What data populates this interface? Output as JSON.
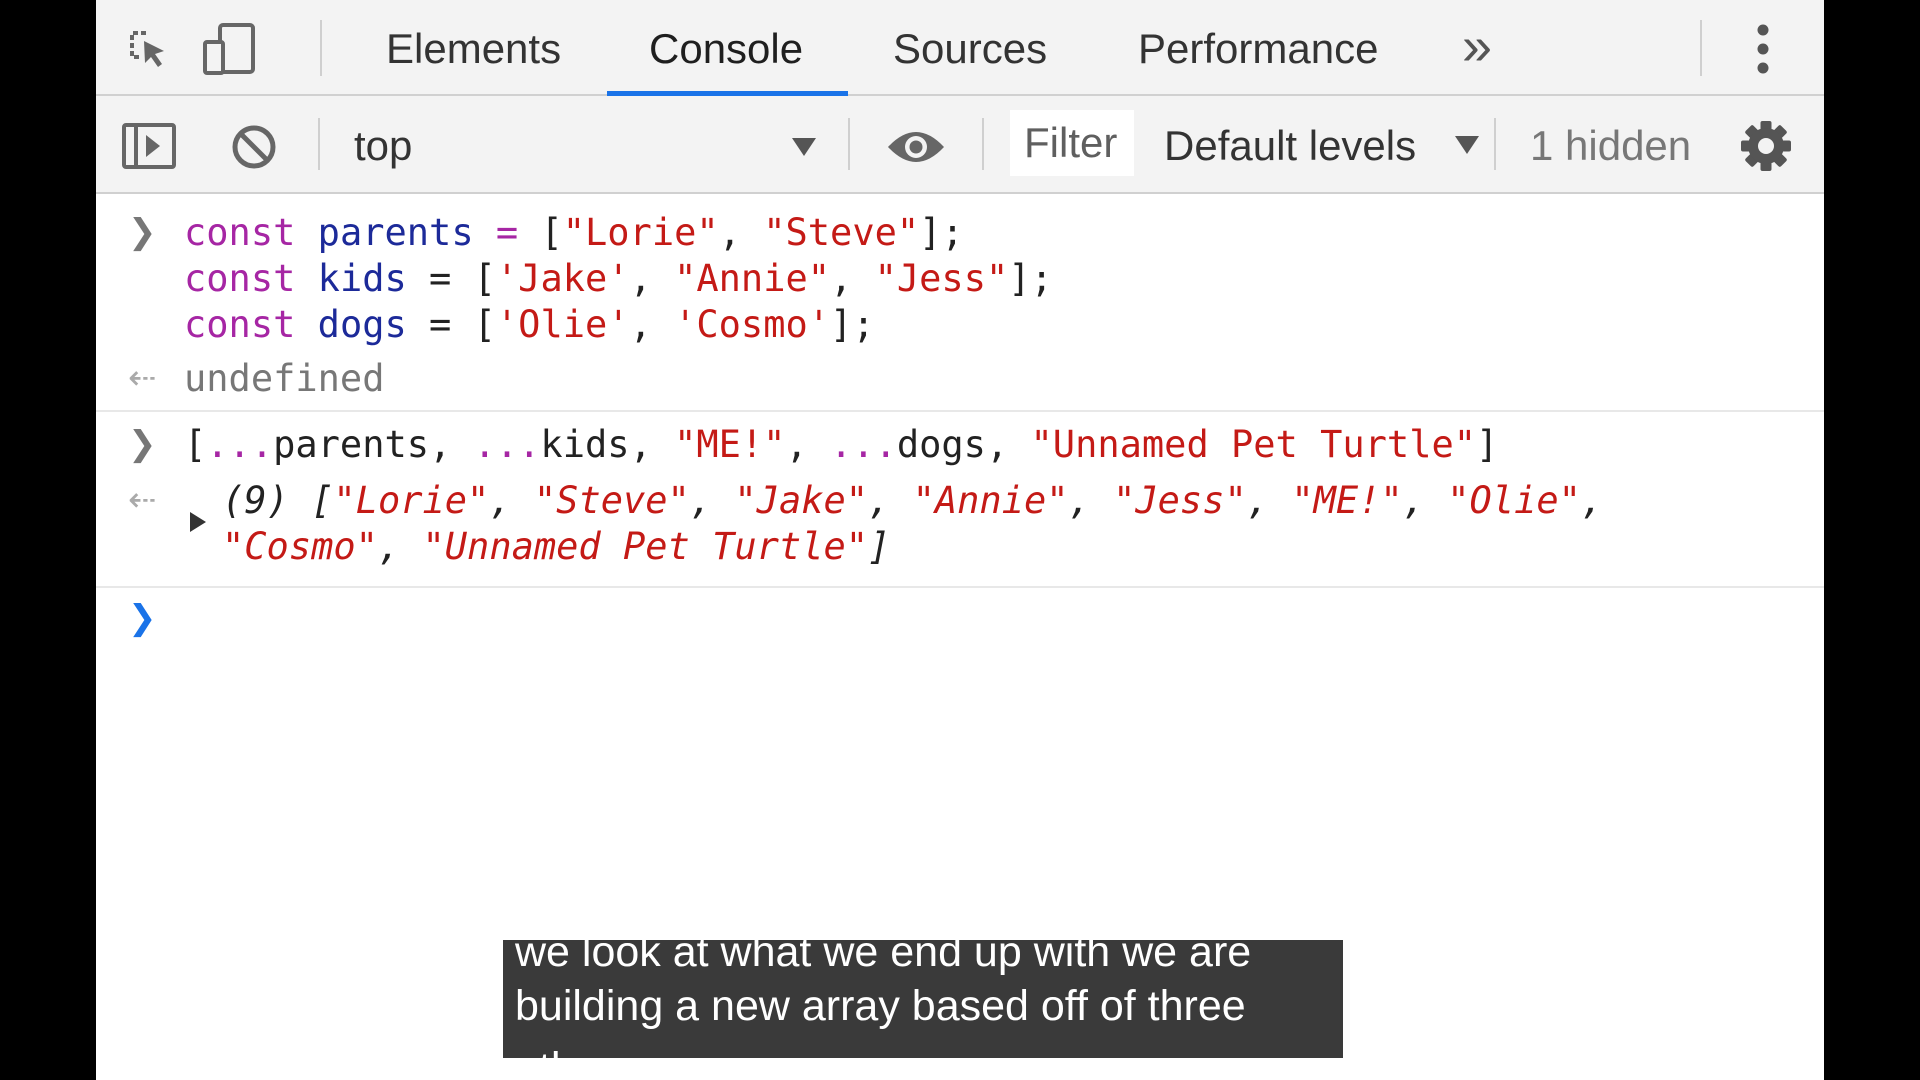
{
  "tabbar": {
    "tabs": [
      {
        "label": "Elements",
        "active": false
      },
      {
        "label": "Console",
        "active": true
      },
      {
        "label": "Sources",
        "active": false
      },
      {
        "label": "Performance",
        "active": false
      }
    ],
    "more_tabs_label": "»",
    "accent_color": "#1a73e8"
  },
  "toolbar": {
    "context": "top",
    "filter_placeholder": "Filter",
    "levels_label": "Default levels",
    "hidden_count": "1 hidden"
  },
  "console": {
    "entries": [
      {
        "lines": [
          [
            "const",
            " ",
            "parents",
            " = ",
            "[",
            "\"Lorie\"",
            ", ",
            "\"Steve\"",
            "];"
          ],
          [
            "const",
            " ",
            "kids",
            " = ",
            "[",
            "'Jake'",
            ", ",
            "\"Annie\"",
            ", ",
            "\"Jess\"",
            "];"
          ],
          [
            "const",
            " ",
            "dogs",
            " = ",
            "[",
            "'Olie'",
            ", ",
            "'Cosmo'",
            "];"
          ]
        ],
        "result": "undefined"
      },
      {
        "input": [
          "[",
          "...",
          "parents, ",
          "...",
          "kids, ",
          "\"ME!\"",
          ", ",
          "...",
          "dogs, ",
          "\"Unnamed Pet Turtle\"",
          "]"
        ],
        "result_count": "(9)",
        "result_items": [
          "\"Lorie\"",
          "\"Steve\"",
          "\"Jake\"",
          "\"Annie\"",
          "\"Jess\"",
          "\"ME!\"",
          "\"Olie\"",
          "\"Cosmo\"",
          "\"Unnamed Pet Turtle\""
        ]
      }
    ],
    "colors": {
      "keyword": "#a626a4",
      "variable": "#1c2a99",
      "string": "#c41a16",
      "prompt": "#1a73e8"
    }
  },
  "caption": {
    "lines": [
      "we look at what we end up with we are",
      "building a new array based off of three",
      "other"
    ]
  }
}
